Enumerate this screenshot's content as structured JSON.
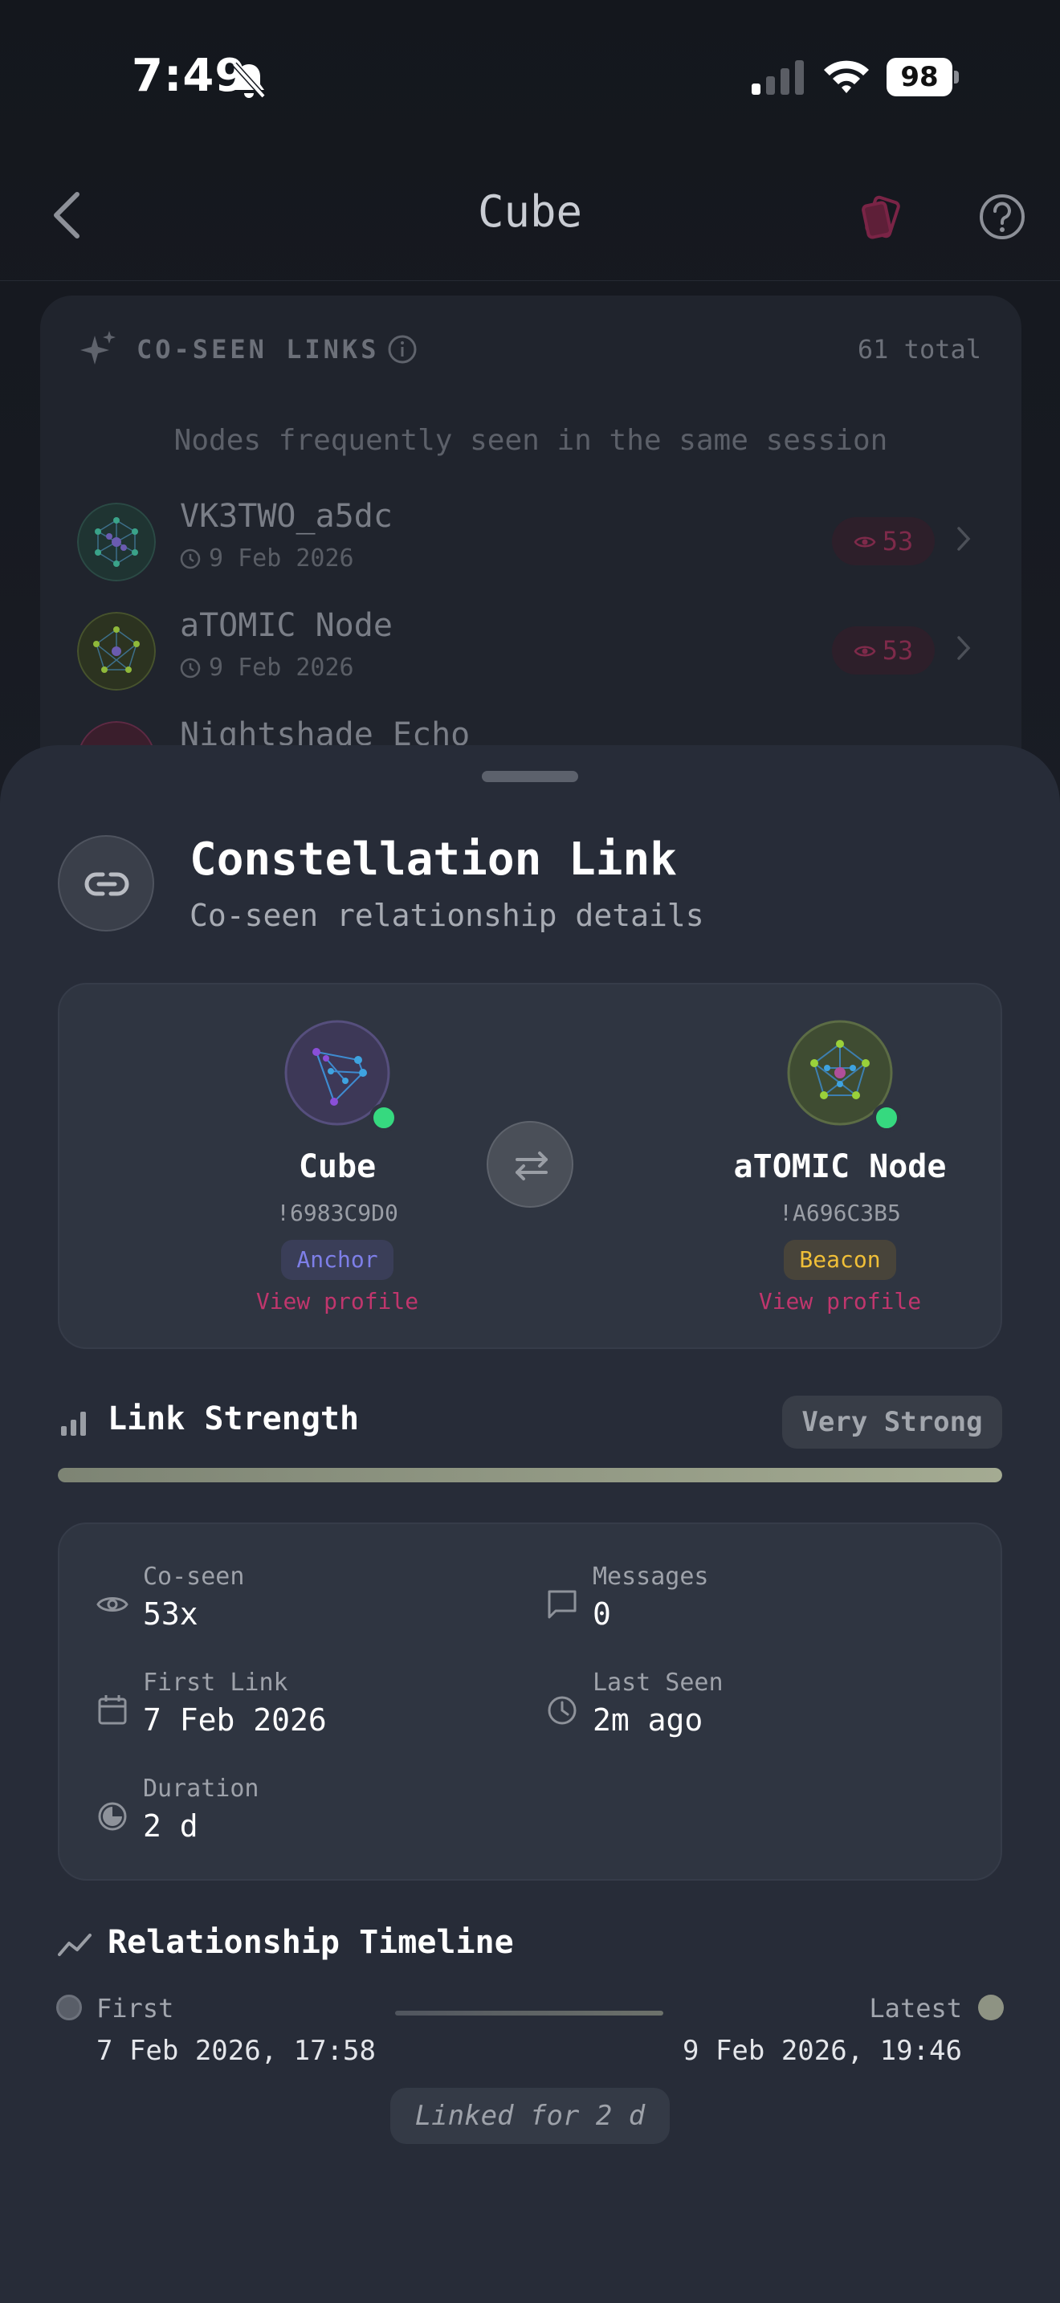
{
  "status_bar": {
    "time": "7:49",
    "battery": "98"
  },
  "nav": {
    "title": "Cube"
  },
  "coseen": {
    "title": "CO-SEEN LINKS",
    "total": "61 total",
    "subtitle": "Nodes frequently seen in the same session",
    "peers": [
      {
        "name": "VK3TWO_a5dc",
        "date": "9 Feb 2026",
        "count": "53"
      },
      {
        "name": "aTOMIC Node",
        "date": "9 Feb 2026",
        "count": "53"
      },
      {
        "name": "Nightshade Echo",
        "date": "",
        "count": ""
      }
    ]
  },
  "sheet": {
    "title": "Constellation Link",
    "subtitle": "Co-seen relationship details",
    "node_a": {
      "name": "Cube",
      "id": "!6983C9D0",
      "role": "Anchor",
      "link": "View profile"
    },
    "node_b": {
      "name": "aTOMIC Node",
      "id": "!A696C3B5",
      "role": "Beacon",
      "link": "View profile"
    },
    "strength": {
      "label": "Link Strength",
      "badge": "Very Strong",
      "level": 1.0
    },
    "stats": {
      "coseen": {
        "label": "Co-seen",
        "value": "53x"
      },
      "messages": {
        "label": "Messages",
        "value": "0"
      },
      "first_link": {
        "label": "First Link",
        "value": "7 Feb 2026"
      },
      "last_seen": {
        "label": "Last Seen",
        "value": "2m ago"
      },
      "duration": {
        "label": "Duration",
        "value": "2 d"
      }
    },
    "timeline": {
      "title": "Relationship Timeline",
      "first_label": "First",
      "first_date": "7 Feb 2026, 17:58",
      "latest_label": "Latest",
      "latest_date": "9 Feb 2026, 19:46",
      "duration_text": "Linked for 2 d"
    }
  },
  "colors": {
    "accent_pink": "#c0366d",
    "anchor": "#7e7fe8",
    "beacon": "#f0bf38",
    "online": "#36d97f",
    "strength_fill": "#a4ab92"
  },
  "icons": [
    "bell-slash-icon",
    "signal-icon",
    "wifi-icon",
    "back-chevron-icon",
    "cards-icon",
    "help-icon",
    "sparkle-icon",
    "info-icon",
    "clock-icon",
    "eye-icon",
    "chevron-right-icon",
    "link-icon",
    "swap-icon",
    "bars-icon",
    "calendar-icon",
    "message-icon",
    "pie-icon",
    "trend-icon"
  ]
}
